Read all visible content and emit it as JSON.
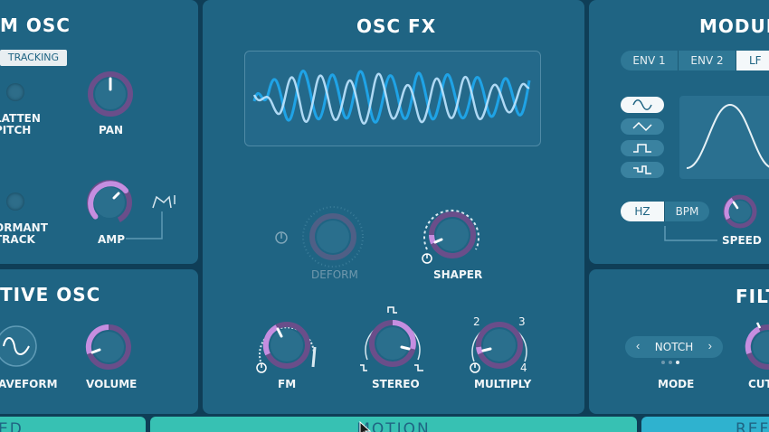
{
  "panels": {
    "left_top": {
      "title": "M OSC",
      "tracking_label": "TRACKING"
    },
    "left_bottom": {
      "title": "TIVE OSC"
    },
    "center": {
      "title": "OSC FX"
    },
    "right_top": {
      "title": "MODUL"
    },
    "right_bottom": {
      "title": "FILT"
    }
  },
  "left_top_controls": {
    "flatten_pitch": "LATTEN\nPITCH",
    "pan": "PAN",
    "formant_track": "ORMANT\nTRACK",
    "amp": "AMP"
  },
  "left_bottom_controls": {
    "waveform": "AVEFORM",
    "volume": "VOLUME"
  },
  "center_controls": {
    "deform": "DEFORM",
    "shaper": "SHAPER",
    "fm": "FM",
    "stereo": "STEREO",
    "multiply": "MULTIPLY",
    "multiply_ticks": {
      "t1": "2",
      "t2": "3",
      "t3": "4"
    }
  },
  "mod": {
    "tabs": [
      "ENV 1",
      "ENV 2",
      "LF"
    ],
    "active_tab": "LF",
    "rate_modes": [
      "HZ",
      "BPM"
    ],
    "active_rate": "HZ",
    "speed_label": "SPEED",
    "wave_shapes": [
      "sine-icon",
      "triangle-icon",
      "square-icon",
      "stepped-icon"
    ]
  },
  "filter": {
    "mode_value": "NOTCH",
    "mode_label": "MODE",
    "cutoff_label": "CUT"
  },
  "bottom_tabs": [
    "ED",
    "MOTION",
    "REF"
  ],
  "colors": {
    "background": "#0f3e57",
    "panel": "#1f6483",
    "knob_accent": "#c58ee0",
    "knob_body": "#2a6f8d",
    "wave_blue": "#1fa3e6",
    "wave_light": "#bfe6ff",
    "bottom_tab": "#37c1b3"
  }
}
